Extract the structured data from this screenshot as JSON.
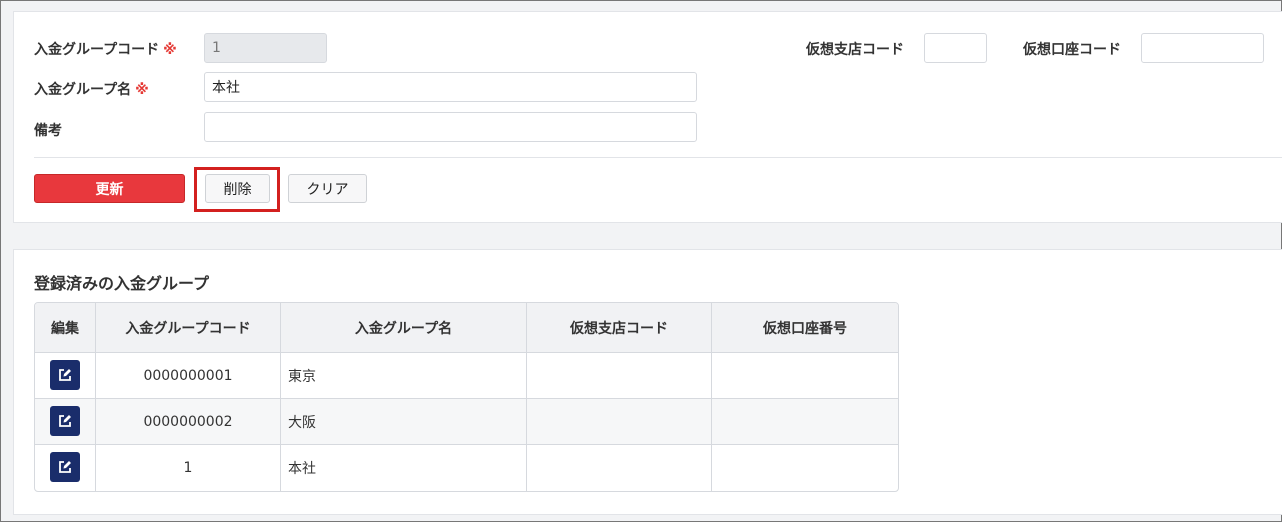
{
  "form": {
    "group_code_label": "入金グループコード",
    "group_code_value": "1",
    "group_name_label": "入金グループ名",
    "group_name_value": "本社",
    "remarks_label": "備考",
    "remarks_value": "",
    "required_mark": "※",
    "virtual_branch_label": "仮想支店コード",
    "virtual_branch_value": "",
    "virtual_account_label": "仮想口座コード",
    "virtual_account_value": ""
  },
  "actions": {
    "update_label": "更新",
    "delete_label": "削除",
    "clear_label": "クリア"
  },
  "list": {
    "title": "登録済みの入金グループ",
    "headers": {
      "edit": "編集",
      "code": "入金グループコード",
      "name": "入金グループ名",
      "branch": "仮想支店コード",
      "account": "仮想口座番号"
    },
    "rows": [
      {
        "code": "0000000001",
        "name": "東京",
        "branch": "",
        "account": ""
      },
      {
        "code": "0000000002",
        "name": "大阪",
        "branch": "",
        "account": ""
      },
      {
        "code": "1",
        "name": "本社",
        "branch": "",
        "account": ""
      }
    ]
  },
  "colors": {
    "primary_button": "#e8383d",
    "edit_button": "#1a2d6b",
    "highlight": "#d3201f",
    "required": "#e53935"
  },
  "icons": {
    "edit": "edit-icon"
  }
}
